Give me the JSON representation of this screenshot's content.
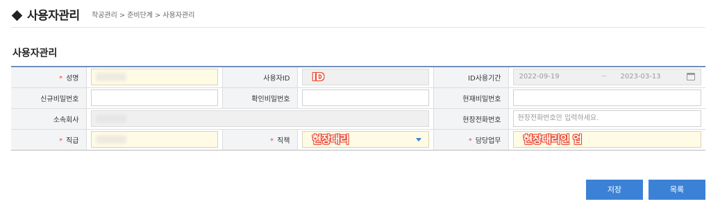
{
  "header": {
    "title": "사용자관리",
    "breadcrumb": [
      "착공관리",
      "준비단계",
      "사용자관리"
    ],
    "breadcrumb_separator": ">"
  },
  "section": {
    "title": "사용자관리"
  },
  "form": {
    "required_mark": "*",
    "name": {
      "label": "성명"
    },
    "user_id": {
      "label": "사용자ID",
      "annotation": "ID"
    },
    "id_period": {
      "label": "ID사용기간",
      "from": "2022-09-19",
      "separator": "~",
      "to": "2023-03-13"
    },
    "new_password": {
      "label": "신규비밀번호",
      "value": ""
    },
    "confirm_password": {
      "label": "확인비밀번호",
      "value": ""
    },
    "current_password": {
      "label": "현재비밀번호",
      "value": ""
    },
    "company": {
      "label": "소속회사"
    },
    "site_phone": {
      "label": "현장전화번호",
      "placeholder": "현장전화번호만 입력하세요."
    },
    "rank": {
      "label": "직급"
    },
    "position": {
      "label": "직책",
      "selected": "현장대리"
    },
    "duty": {
      "label": "담당업무",
      "annotation": "현장대리인 업"
    }
  },
  "buttons": {
    "save": "저장",
    "list": "목록"
  },
  "colors": {
    "accent": "#3b82d6",
    "annotation": "#e8432c",
    "required": "#d9534f",
    "highlight": "#fffbe5"
  },
  "icons": {
    "title": "diamond-icon",
    "date": "calendar-icon",
    "select": "caret-down-icon"
  }
}
